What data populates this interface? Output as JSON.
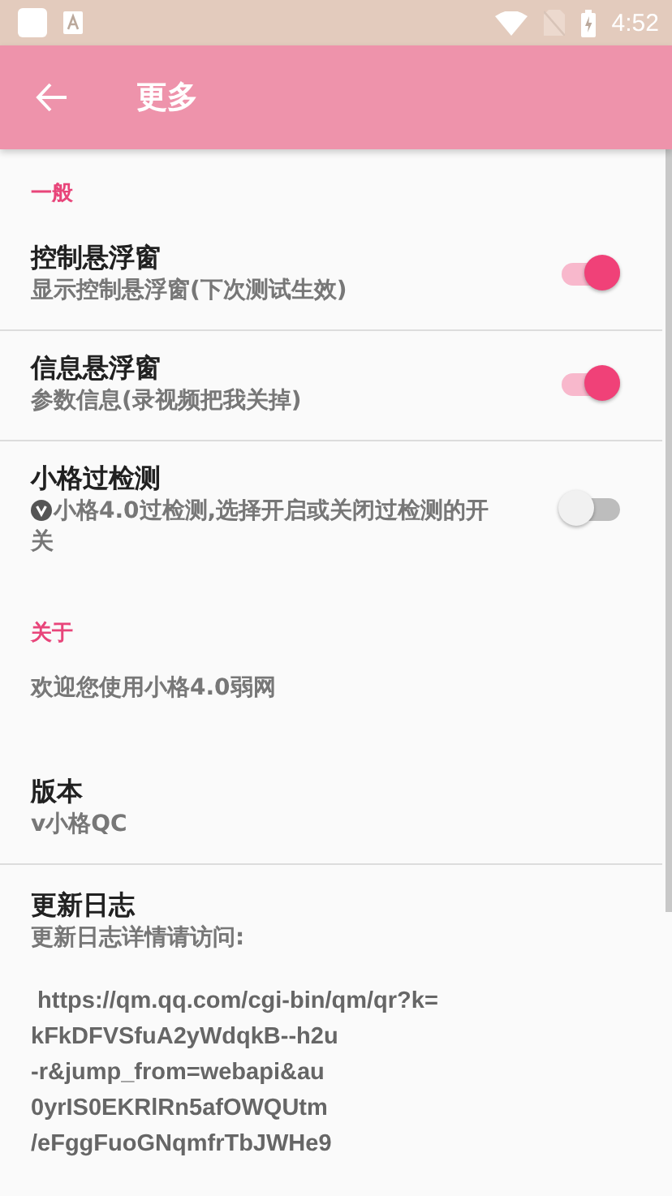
{
  "status_bar": {
    "time": "4:52"
  },
  "app_bar": {
    "title": "更多"
  },
  "sections": [
    {
      "header": "一般",
      "items": [
        {
          "kind": "switch",
          "title": "控制悬浮窗",
          "summary": "显示控制悬浮窗(下次测试生效)",
          "on": true,
          "divider": true
        },
        {
          "kind": "switch",
          "title": "信息悬浮窗",
          "summary": "参数信息(录视频把我关掉)",
          "on": true,
          "divider": true
        },
        {
          "kind": "switch",
          "title": "小格过检测",
          "summary": "小格4.0过检测,选择开启或关闭过检测的开关",
          "badge": true,
          "on": false,
          "divider": false
        }
      ]
    },
    {
      "header": "关于",
      "items": [
        {
          "kind": "text",
          "summary": "欢迎您使用小格4.0弱网",
          "divider": false
        },
        {
          "kind": "text",
          "title": "版本",
          "summary": "v小格QC",
          "divider": true
        },
        {
          "kind": "text",
          "title": "更新日志",
          "summary": "更新日志详情请访问:",
          "lines": [
            " https://qm.qq.com/cgi-bin/qm/qr?k=",
            "kFkDFVSfuA2yWdqkB--h2u",
            "-r&jump_from=webapi&au",
            "0yrIS0EKRlRn5afOWQUtm",
            "/eFggFuoGNqmfrTbJWHe9"
          ]
        }
      ]
    }
  ]
}
